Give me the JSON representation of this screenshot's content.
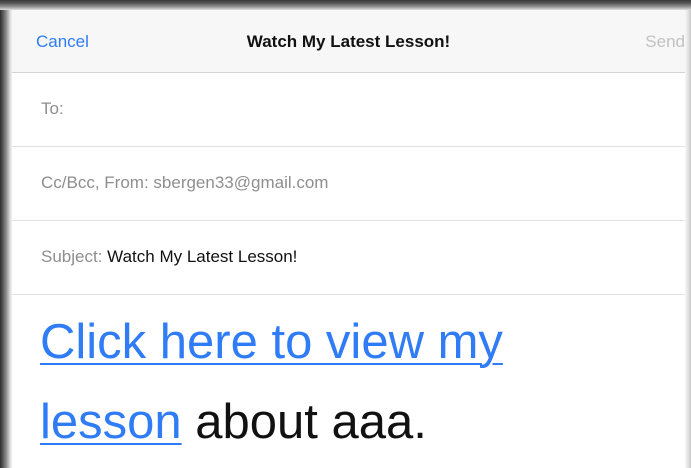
{
  "navbar": {
    "cancel_label": "Cancel",
    "title": "Watch My Latest Lesson!",
    "send_label": "Send"
  },
  "fields": {
    "to_label": "To:",
    "ccbcc_label": "Cc/Bcc, From:",
    "from_value": "sbergen33@gmail.com",
    "subject_label": "Subject:",
    "subject_value": "Watch My Latest Lesson!"
  },
  "body": {
    "link_line1": "Click here to view my",
    "link_line2": "lesson",
    "text_after_link": "about aaa."
  },
  "colors": {
    "accent": "#2f7cf6",
    "disabled": "#c2c2c2",
    "label_gray": "#8e8e8e",
    "text": "#111111"
  }
}
